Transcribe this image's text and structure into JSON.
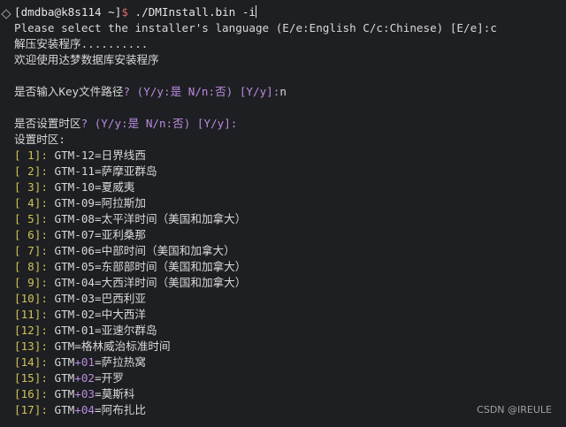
{
  "scroll_remnant": {
    "left": "",
    "highlight": ""
  },
  "prompt": {
    "open_bracket": "[",
    "user_host": "dmdba@k8s114",
    "cwd": " ~",
    "close_bracket": "]",
    "dollar": "$",
    "command": " ./DMInstall.bin -i"
  },
  "language_prompt": {
    "text": "Please select the installer's language (E/e:English C/c:Chinese) [E/e]:",
    "answer": "c"
  },
  "extracting": "解压安装程序..........",
  "welcome": "欢迎使用达梦数据库安装程序",
  "key_prompt": {
    "question": "是否输入Key文件路径",
    "options": "? (Y/y:是 N/n:否) [Y/y]:",
    "answer": "n"
  },
  "timezone_prompt": {
    "question": "是否设置时区",
    "options": "? (Y/y:是 N/n:否) [Y/y]:"
  },
  "set_timezone_label": "设置时区:",
  "timezones": [
    {
      "index": "[ 1]",
      "sep": ": ",
      "prefix": "GTM-12=",
      "offset": "",
      "name": "日界线西"
    },
    {
      "index": "[ 2]",
      "sep": ": ",
      "prefix": "GTM-11=",
      "offset": "",
      "name": "萨摩亚群岛"
    },
    {
      "index": "[ 3]",
      "sep": ": ",
      "prefix": "GTM-10=",
      "offset": "",
      "name": "夏威夷"
    },
    {
      "index": "[ 4]",
      "sep": ": ",
      "prefix": "GTM-09=",
      "offset": "",
      "name": "阿拉斯加"
    },
    {
      "index": "[ 5]",
      "sep": ": ",
      "prefix": "GTM-08=",
      "offset": "",
      "name": "太平洋时间（美国和加拿大）"
    },
    {
      "index": "[ 6]",
      "sep": ": ",
      "prefix": "GTM-07=",
      "offset": "",
      "name": "亚利桑那"
    },
    {
      "index": "[ 7]",
      "sep": ": ",
      "prefix": "GTM-06=",
      "offset": "",
      "name": "中部时间（美国和加拿大）"
    },
    {
      "index": "[ 8]",
      "sep": ": ",
      "prefix": "GTM-05=",
      "offset": "",
      "name": "东部部时间（美国和加拿大）"
    },
    {
      "index": "[ 9]",
      "sep": ": ",
      "prefix": "GTM-04=",
      "offset": "",
      "name": "大西洋时间（美国和加拿大）"
    },
    {
      "index": "[10]",
      "sep": ": ",
      "prefix": "GTM-03=",
      "offset": "",
      "name": "巴西利亚"
    },
    {
      "index": "[11]",
      "sep": ": ",
      "prefix": "GTM-02=",
      "offset": "",
      "name": "中大西洋"
    },
    {
      "index": "[12]",
      "sep": ": ",
      "prefix": "GTM-01=",
      "offset": "",
      "name": "亚速尔群岛"
    },
    {
      "index": "[13]",
      "sep": ": ",
      "prefix": "GTM=",
      "offset": "",
      "name": "格林威治标准时间"
    },
    {
      "index": "[14]",
      "sep": ": ",
      "prefix": "GTM",
      "offset": "+01",
      "name": "=萨拉热窝"
    },
    {
      "index": "[15]",
      "sep": ": ",
      "prefix": "GTM",
      "offset": "+02",
      "name": "=开罗"
    },
    {
      "index": "[16]",
      "sep": ": ",
      "prefix": "GTM",
      "offset": "+03",
      "name": "=莫斯科"
    },
    {
      "index": "[17]",
      "sep": ": ",
      "prefix": "GTM",
      "offset": "+04",
      "name": "=阿布扎比"
    }
  ],
  "watermark": "CSDN @IREULE",
  "colors": {
    "background": "#1e1f22",
    "text": "#d8d8d8",
    "bracket_yellow": "#cfc25a",
    "purple": "#b98be0",
    "prompt_red": "#d86a6a"
  }
}
